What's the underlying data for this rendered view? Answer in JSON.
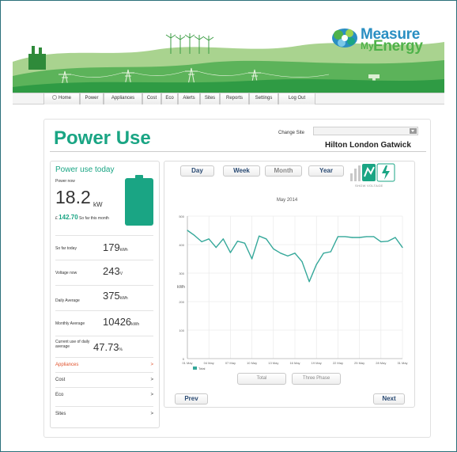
{
  "brand": {
    "line1": "Measure",
    "line2_small": "My",
    "line2_big": "Energy",
    "colors": {
      "blue": "#2a8fc2",
      "green": "#4fb24a",
      "accent": "#1aa584"
    }
  },
  "nav": {
    "items": [
      {
        "label": "Home",
        "icon": "home-icon"
      },
      {
        "label": "Power"
      },
      {
        "label": "Appliances"
      },
      {
        "label": "Cost"
      },
      {
        "label": "Eco"
      },
      {
        "label": "Alerts"
      },
      {
        "label": "Sites"
      },
      {
        "label": "Reports"
      },
      {
        "label": "Settings"
      },
      {
        "label": "Log Out"
      }
    ]
  },
  "page": {
    "title": "Power Use",
    "change_site_label": "Change Site",
    "site_name": "Hilton London Gatwick"
  },
  "summary": {
    "title": "Power use today",
    "power_now_label": "Power now",
    "power_now_value": "18.2",
    "power_now_unit": "kW",
    "money_prefix": "£ ",
    "money_value": "142.70",
    "money_suffix": " So far this month",
    "stats": [
      {
        "label": "So far today",
        "value": "179",
        "unit": "kWh"
      },
      {
        "label": "Voltage now",
        "value": "243",
        "unit": "V"
      },
      {
        "label": "Daily Average",
        "value": "375",
        "unit": "kWh"
      },
      {
        "label": "Monthly Average",
        "value": "10426",
        "unit": "kWh"
      },
      {
        "label": "Current use of daily average",
        "value": "47.73",
        "unit": "%"
      }
    ],
    "menu": [
      {
        "label": "Appliances",
        "arrow": ">",
        "active": true
      },
      {
        "label": "Cost",
        "arrow": ">"
      },
      {
        "label": "Eco",
        "arrow": ">"
      },
      {
        "label": "Sites",
        "arrow": ">"
      }
    ]
  },
  "chart_controls": {
    "periods": [
      "Day",
      "Week",
      "Month",
      "Year"
    ],
    "selected_period": "Month",
    "show_voltage": "SHOW VOLTAGE",
    "phase_buttons": [
      "Total",
      "Three Phase"
    ],
    "prev": "Prev",
    "next": "Next"
  },
  "chart_data": {
    "type": "line",
    "title": "May 2014",
    "ylabel": "kWh",
    "ylim": [
      0,
      500
    ],
    "yticks": [
      0,
      100,
      200,
      300,
      400,
      500
    ],
    "x": [
      "01 May",
      "02 May",
      "03 May",
      "04 May",
      "05 May",
      "06 May",
      "07 May",
      "08 May",
      "09 May",
      "10 May",
      "11 May",
      "12 May",
      "13 May",
      "14 May",
      "15 May",
      "16 May",
      "17 May",
      "18 May",
      "19 May",
      "20 May",
      "21 May",
      "22 May",
      "23 May",
      "24 May",
      "25 May",
      "26 May",
      "27 May",
      "28 May",
      "29 May",
      "30 May",
      "31 May"
    ],
    "xtick_labels": [
      "01 May",
      "04 May",
      "07 May",
      "10 May",
      "13 May",
      "16 May",
      "19 May",
      "22 May",
      "25 May",
      "28 May",
      "31 May"
    ],
    "grid": true,
    "legend": "bottom-left",
    "series": [
      {
        "name": "Total",
        "color": "#35a89a",
        "values": [
          450,
          432,
          410,
          420,
          390,
          420,
          372,
          412,
          405,
          350,
          430,
          420,
          385,
          370,
          360,
          370,
          340,
          270,
          330,
          370,
          375,
          428,
          428,
          425,
          425,
          428,
          428,
          410,
          412,
          425,
          390
        ]
      }
    ]
  }
}
